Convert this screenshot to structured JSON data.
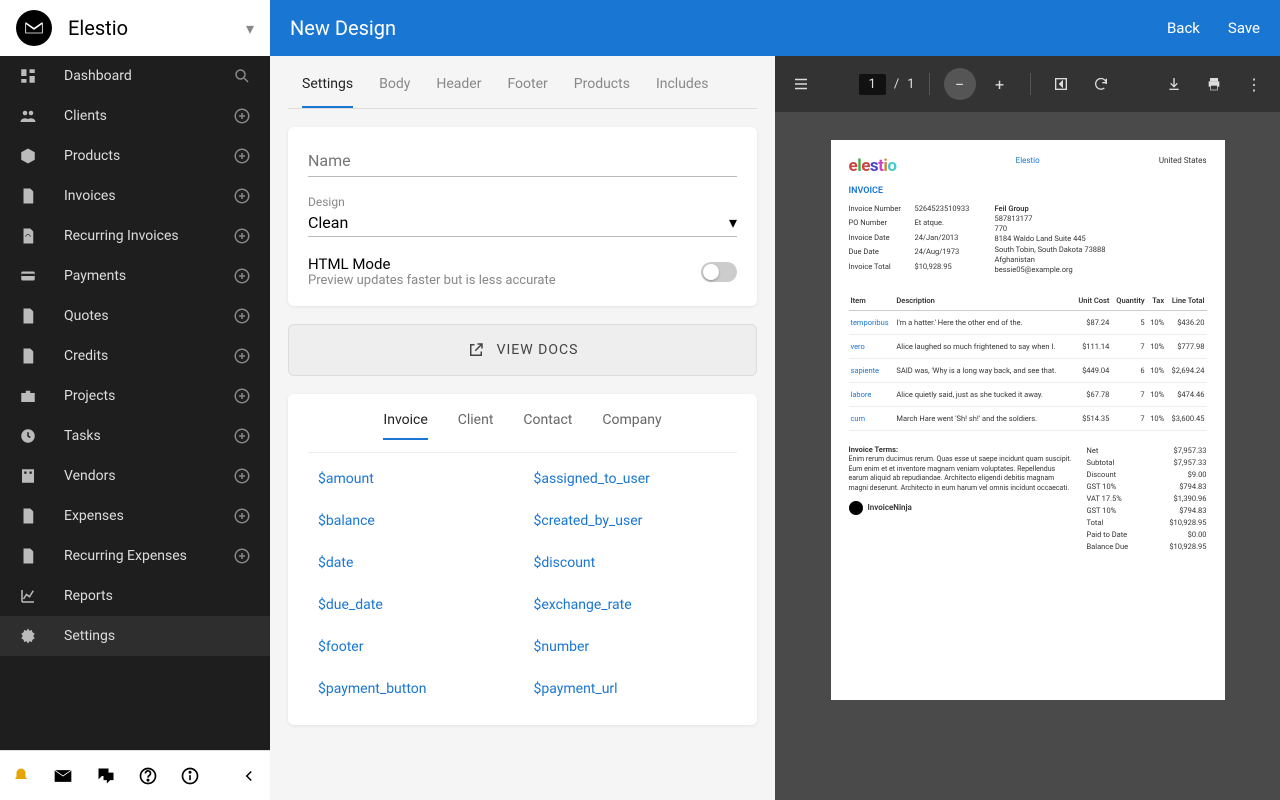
{
  "brand": {
    "name": "Elestio"
  },
  "sidebar": {
    "items": [
      {
        "label": "Dashboard",
        "icon": "dashboard",
        "action": "search"
      },
      {
        "label": "Clients",
        "icon": "people",
        "action": "add"
      },
      {
        "label": "Products",
        "icon": "box",
        "action": "add"
      },
      {
        "label": "Invoices",
        "icon": "file",
        "action": "add"
      },
      {
        "label": "Recurring Invoices",
        "icon": "repeat-file",
        "action": "add"
      },
      {
        "label": "Payments",
        "icon": "card",
        "action": "add"
      },
      {
        "label": "Quotes",
        "icon": "quote-file",
        "action": "add"
      },
      {
        "label": "Credits",
        "icon": "credit-file",
        "action": "add"
      },
      {
        "label": "Projects",
        "icon": "briefcase",
        "action": "add"
      },
      {
        "label": "Tasks",
        "icon": "clock",
        "action": "add"
      },
      {
        "label": "Vendors",
        "icon": "building",
        "action": "add"
      },
      {
        "label": "Expenses",
        "icon": "expense-file",
        "action": "add"
      },
      {
        "label": "Recurring Expenses",
        "icon": "repeat-expense",
        "action": "add"
      },
      {
        "label": "Reports",
        "icon": "chart",
        "action": "none"
      },
      {
        "label": "Settings",
        "icon": "gear",
        "action": "none",
        "active": true
      }
    ]
  },
  "topbar": {
    "title": "New Design",
    "back": "Back",
    "save": "Save"
  },
  "tabs": [
    "Settings",
    "Body",
    "Header",
    "Footer",
    "Products",
    "Includes"
  ],
  "settings": {
    "name_label": "Name",
    "design_label": "Design",
    "design_value": "Clean",
    "html_title": "HTML Mode",
    "html_desc": "Preview updates faster but is less accurate",
    "view_docs": "VIEW DOCS"
  },
  "subtabs": [
    "Invoice",
    "Client",
    "Contact",
    "Company"
  ],
  "vars": [
    "$amount",
    "$assigned_to_user",
    "$balance",
    "$created_by_user",
    "$date",
    "$discount",
    "$due_date",
    "$exchange_rate",
    "$footer",
    "$number",
    "$payment_button",
    "$payment_url"
  ],
  "preview": {
    "page_current": "1",
    "page_sep": "/",
    "page_total": "1"
  },
  "doc": {
    "company": "Elestio",
    "country": "United States",
    "title": "INVOICE",
    "meta_labels": [
      "Invoice Number",
      "PO Number",
      "Invoice Date",
      "Due Date",
      "Invoice Total"
    ],
    "meta_values": [
      "5264523510933",
      "Et atque.",
      "24/Jan/2013",
      "24/Aug/1973",
      "$10,928.95"
    ],
    "client": {
      "name": "Feil Group",
      "id": "587813177",
      "num": "770",
      "addr1": "8184 Waldo Land Suite 445",
      "addr2": "South Tobin, South Dakota 73888",
      "country": "Afghanistan",
      "email": "bessie05@example.org"
    },
    "cols": [
      "Item",
      "Description",
      "Unit Cost",
      "Quantity",
      "Tax",
      "Line Total"
    ],
    "rows": [
      {
        "item": "temporibus",
        "desc": "I'm a hatter.' Here the other end of the.",
        "cost": "$87.24",
        "qty": "5",
        "tax": "10%",
        "total": "$436.20"
      },
      {
        "item": "vero",
        "desc": "Alice laughed so much frightened to say when I.",
        "cost": "$111.14",
        "qty": "7",
        "tax": "10%",
        "total": "$777.98"
      },
      {
        "item": "sapiente",
        "desc": "SAID was, 'Why is a long way back, and see that.",
        "cost": "$449.04",
        "qty": "6",
        "tax": "10%",
        "total": "$2,694.24"
      },
      {
        "item": "labore",
        "desc": "Alice quietly said, just as she tucked it away.",
        "cost": "$67.78",
        "qty": "7",
        "tax": "10%",
        "total": "$474.46"
      },
      {
        "item": "cum",
        "desc": "March Hare went 'Sh! sh!' and the soldiers.",
        "cost": "$514.35",
        "qty": "7",
        "tax": "10%",
        "total": "$3,600.45"
      }
    ],
    "terms_label": "Invoice Terms:",
    "terms": "Enim rerum ducimus rerum. Quas esse ut saepe incidunt quam suscipit. Eum enim et et inventore magnam veniam voluptates. Repellendus earum aliquid ab repudiandae. Architecto eligendi debitis magnam magni deserunt. Architecto in eum harum vel omnis incidunt occaecati.",
    "ninja": "InvoiceNinja",
    "totals": [
      {
        "l": "Net",
        "v": "$7,957.33"
      },
      {
        "l": "Subtotal",
        "v": "$7,957.33"
      },
      {
        "l": "Discount",
        "v": "$9.00"
      },
      {
        "l": "GST 10%",
        "v": "$794.83"
      },
      {
        "l": "VAT 17.5%",
        "v": "$1,390.96"
      },
      {
        "l": "GST 10%",
        "v": "$794.83"
      },
      {
        "l": "Total",
        "v": "$10,928.95"
      },
      {
        "l": "Paid to Date",
        "v": "$0.00"
      },
      {
        "l": "Balance Due",
        "v": "$10,928.95"
      }
    ]
  }
}
